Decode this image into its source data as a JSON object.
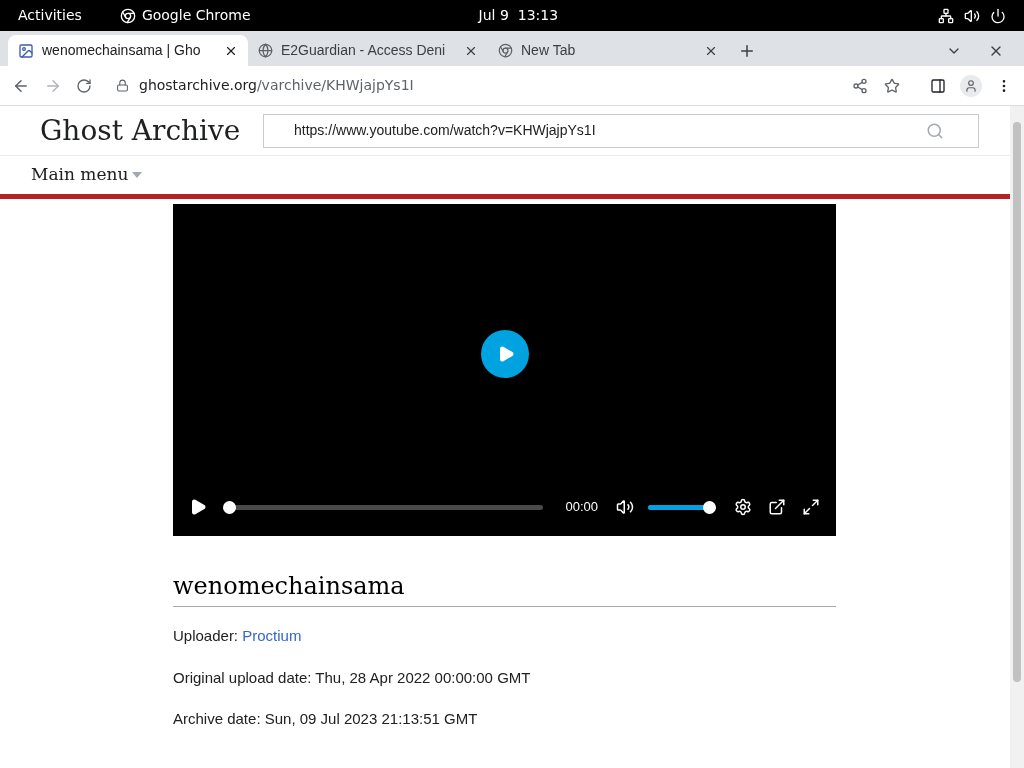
{
  "topbar": {
    "activities": "Activities",
    "app": "Google Chrome",
    "clock": "Jul 9  13:13"
  },
  "tabs": [
    {
      "title": "wenomechainsama | Gho",
      "selected": true,
      "kind": "site"
    },
    {
      "title": "E2Guardian - Access Deni",
      "selected": false,
      "kind": "globe"
    },
    {
      "title": "New Tab",
      "selected": false,
      "kind": "chrome"
    }
  ],
  "address": {
    "host": "ghostarchive.org",
    "path": "/varchive/KHWjajpYs1I"
  },
  "site": {
    "logo": "Ghost Archive",
    "search_value": "https://www.youtube.com/watch?v=KHWjajpYs1I",
    "menu": "Main menu"
  },
  "player": {
    "time": "00:00",
    "progress": {
      "level": 0
    },
    "volume": {
      "level": 1
    }
  },
  "video": {
    "title": "wenomechainsama",
    "uploader_label": "Uploader:",
    "uploader": "Proctium",
    "original_upload": "Original upload date: Thu, 28 Apr 2022 00:00:00 GMT",
    "archive_date": "Archive date: Sun, 09 Jul 2023 21:13:51 GMT"
  }
}
